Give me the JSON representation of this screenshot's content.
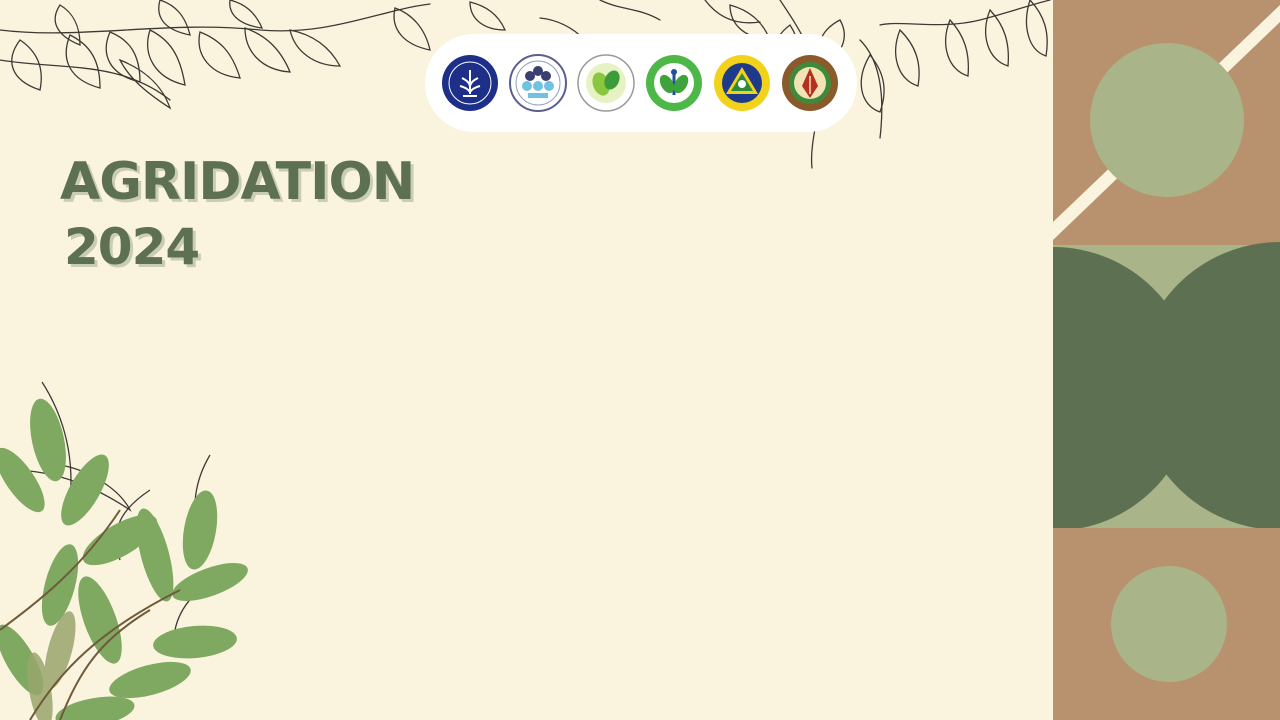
{
  "slide": {
    "title_line_1": "AGRIDATION",
    "title_line_2": "2024"
  },
  "logos": [
    {
      "icon": "ipb-university-logo",
      "bg": "#1E2F8A"
    },
    {
      "icon": "organization-logo-blue-circles",
      "bg": "#FFFFFF"
    },
    {
      "icon": "organization-logo-green-leaf",
      "bg": "#FFFFFF"
    },
    {
      "icon": "organization-logo-green-emblem",
      "bg": "#4DB848"
    },
    {
      "icon": "organization-logo-yellow-triangle",
      "bg": "#F2D21B"
    },
    {
      "icon": "organization-logo-brown-pen",
      "bg": "#8A5A2B"
    }
  ],
  "colors": {
    "background": "#FAF4DF",
    "title": "#5E7052",
    "title_shadow": "#C9CDB1",
    "panel_tan": "#B8926E",
    "panel_sage": "#A9B488",
    "panel_dark_green": "#5E7052",
    "leaf_green": "#7FA860"
  }
}
